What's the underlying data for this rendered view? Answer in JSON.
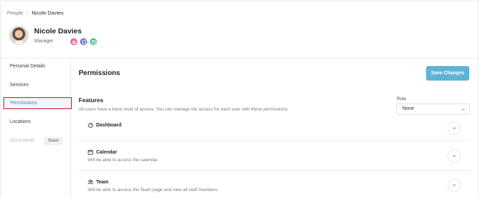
{
  "breadcrumb": {
    "parent": "People",
    "separator": "›",
    "current": "Nicole Davies"
  },
  "user": {
    "name": "Nicole Davies",
    "role": "Manager"
  },
  "badges": [
    {
      "icon": "people-badge-icon",
      "color": "#e86aa8"
    },
    {
      "icon": "services-badge-icon",
      "color": "#6f74e0"
    },
    {
      "icon": "calendar-badge-icon",
      "color": "#4fc08d"
    }
  ],
  "sidebar": {
    "items": [
      {
        "label": "Personal Details"
      },
      {
        "label": "Services"
      },
      {
        "label": "Permissions"
      },
      {
        "label": "Locations"
      },
      {
        "label": "Documents"
      }
    ],
    "soon_badge": "Soon"
  },
  "main": {
    "title": "Permissions",
    "save_label": "Save Changes",
    "features_title": "Features",
    "features_desc": "All users have a basic level of access. You can manage the access for each user with these permissions.",
    "role_label": "Role",
    "role_value": "None",
    "features": [
      {
        "name": "Dashboard",
        "icon": "dashboard-icon",
        "desc": ""
      },
      {
        "name": "Calendar",
        "icon": "calendar-icon",
        "desc": "Will be able to access the calendar."
      },
      {
        "name": "Team",
        "icon": "team-icon",
        "desc": "Will be able to access the Team page and view all staff members."
      }
    ]
  },
  "colors": {
    "accent": "#5fb4d6",
    "active_link": "#3f86c5",
    "highlight_border": "#c8102e"
  }
}
